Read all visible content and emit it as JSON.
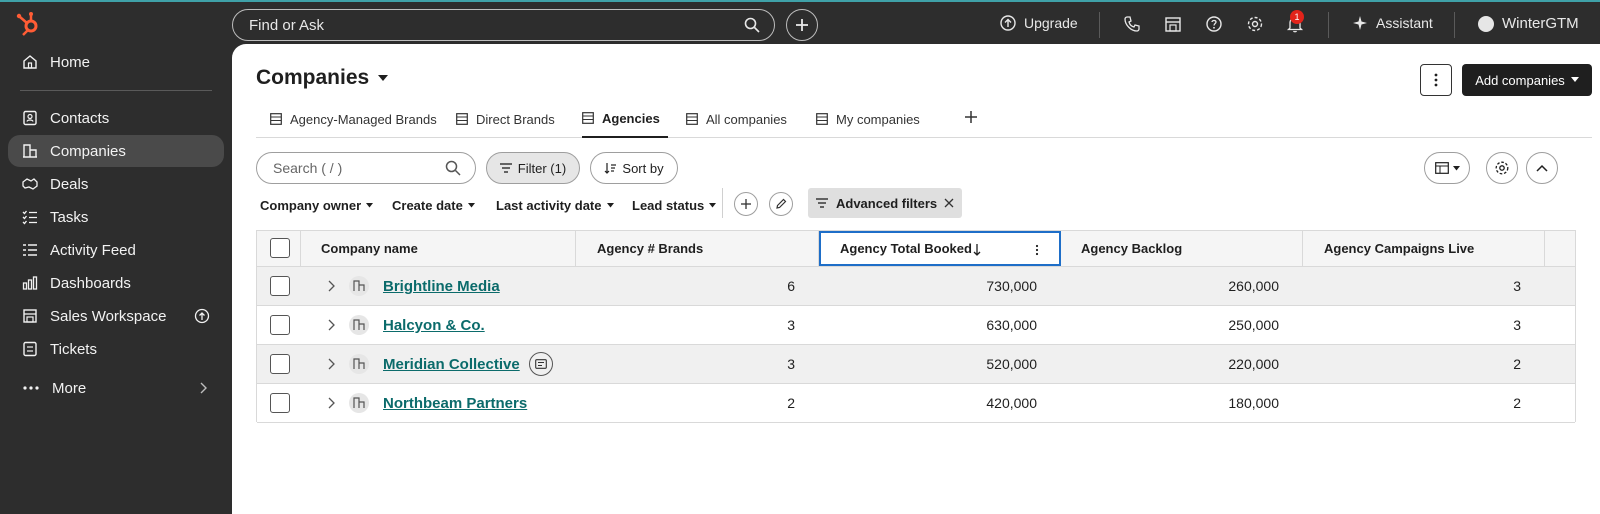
{
  "topbar": {
    "search_placeholder": "Find or Ask",
    "upgrade_label": "Upgrade",
    "notification_count": "1",
    "assistant_label": "Assistant",
    "account_name": "WinterGTM"
  },
  "sidebar": {
    "items": [
      {
        "label": "Home",
        "icon": "home-icon"
      },
      {
        "label": "Contacts",
        "icon": "contacts-icon"
      },
      {
        "label": "Companies",
        "icon": "companies-icon",
        "active": true
      },
      {
        "label": "Deals",
        "icon": "deals-icon"
      },
      {
        "label": "Tasks",
        "icon": "tasks-icon"
      },
      {
        "label": "Activity Feed",
        "icon": "activity-feed-icon"
      },
      {
        "label": "Dashboards",
        "icon": "dashboards-icon"
      },
      {
        "label": "Sales Workspace",
        "icon": "sales-workspace-icon"
      },
      {
        "label": "Tickets",
        "icon": "tickets-icon"
      },
      {
        "label": "More",
        "icon": "more-icon"
      }
    ]
  },
  "page": {
    "title": "Companies",
    "add_button": "Add companies"
  },
  "tabs": [
    {
      "label": "Agency-Managed Brands"
    },
    {
      "label": "Direct Brands"
    },
    {
      "label": "Agencies",
      "active": true
    },
    {
      "label": "All companies"
    },
    {
      "label": "My companies"
    }
  ],
  "toolbar": {
    "search_placeholder": "Search ( / )",
    "filter_label": "Filter (1)",
    "sort_label": "Sort by"
  },
  "quick_filters": [
    "Company owner",
    "Create date",
    "Last activity date",
    "Lead status"
  ],
  "advanced_filters_label": "Advanced filters",
  "table": {
    "columns": [
      "Company name",
      "Agency # Brands",
      "Agency Total Booked",
      "Agency Backlog",
      "Agency Campaigns Live"
    ],
    "sorted_column": "Agency Total Booked",
    "rows": [
      {
        "name": "Brightline Media",
        "brands": "6",
        "total_booked": "730,000",
        "backlog": "260,000",
        "campaigns_live": "3"
      },
      {
        "name": "Halcyon & Co.",
        "brands": "3",
        "total_booked": "630,000",
        "backlog": "250,000",
        "campaigns_live": "3"
      },
      {
        "name": "Meridian Collective",
        "brands": "3",
        "total_booked": "520,000",
        "backlog": "220,000",
        "campaigns_live": "2"
      },
      {
        "name": "Northbeam Partners",
        "brands": "2",
        "total_booked": "420,000",
        "backlog": "180,000",
        "campaigns_live": "2"
      }
    ]
  },
  "colors": {
    "brand_orange": "#ff5c35",
    "link_teal": "#0b6b6b",
    "sort_focus_blue": "#1e6ec8",
    "notification_red": "#e2231a"
  }
}
